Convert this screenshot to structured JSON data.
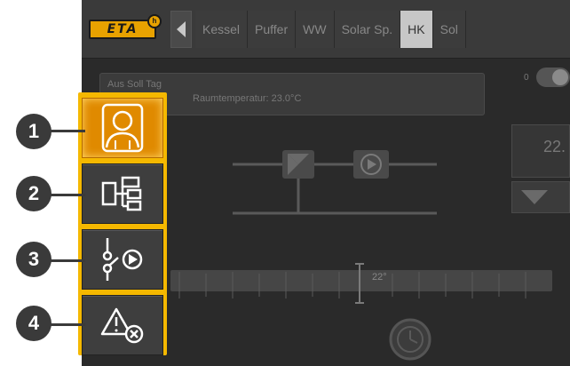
{
  "header": {
    "logo_text": "ETA",
    "tabs": [
      {
        "label": "Kessel",
        "active": false
      },
      {
        "label": "Puffer",
        "active": false
      },
      {
        "label": "WW",
        "active": false
      },
      {
        "label": "Solar Sp.",
        "active": false
      },
      {
        "label": "HK",
        "active": true
      },
      {
        "label": "Sol",
        "active": false
      }
    ]
  },
  "info": {
    "line1": "Aus Soll Tag",
    "line2": "Raumtemperatur: 23.0°C"
  },
  "toggle": {
    "label": "0"
  },
  "right_panel": {
    "value": "22."
  },
  "slider": {
    "value_label": "22°"
  },
  "menu": {
    "items": [
      {
        "number": "1",
        "name": "user",
        "active": true
      },
      {
        "number": "2",
        "name": "structure",
        "active": false
      },
      {
        "number": "3",
        "name": "inputs-outputs",
        "active": false
      },
      {
        "number": "4",
        "name": "errors",
        "active": false
      }
    ]
  },
  "colors": {
    "accent": "#f5b800",
    "active_button": "#e08a00",
    "screen_bg": "#2a2a2a"
  }
}
